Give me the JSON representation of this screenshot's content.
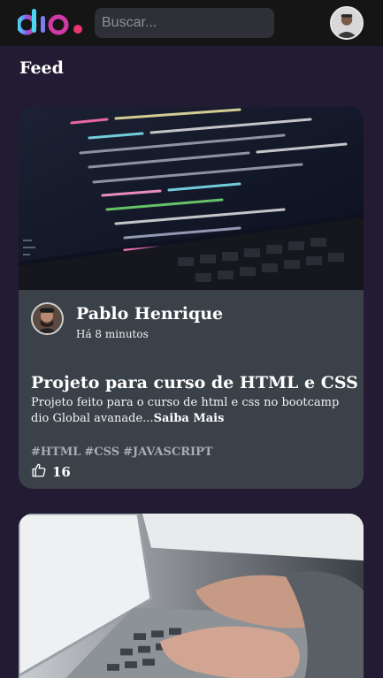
{
  "header": {
    "logo_icon": "dio-logo",
    "search": {
      "placeholder": "Buscar...",
      "value": ""
    },
    "avatar_icon": "user-avatar"
  },
  "feed": {
    "title": "Feed",
    "cards": [
      {
        "image": "code-on-laptop-screen",
        "author": {
          "name": "Pablo Henrique",
          "time": "Há 8 minutos"
        },
        "title": "Projeto para curso de HTML e CSS",
        "description": "Projeto feito para o curso de html e css no bootcamp dio Global avanade...",
        "more": "Saiba Mais",
        "tags": [
          "#HTML",
          "#CSS",
          "#JAVASCRIPT"
        ],
        "likes": "16"
      },
      {
        "image": "hands-typing-on-laptop"
      }
    ]
  },
  "colors": {
    "background": "#221b33",
    "header": "#151515",
    "card": "#3b4148",
    "logo_gradient_start": "#4ad7f5",
    "logo_gradient_end": "#e8356d",
    "tag": "#a7aeb6"
  }
}
